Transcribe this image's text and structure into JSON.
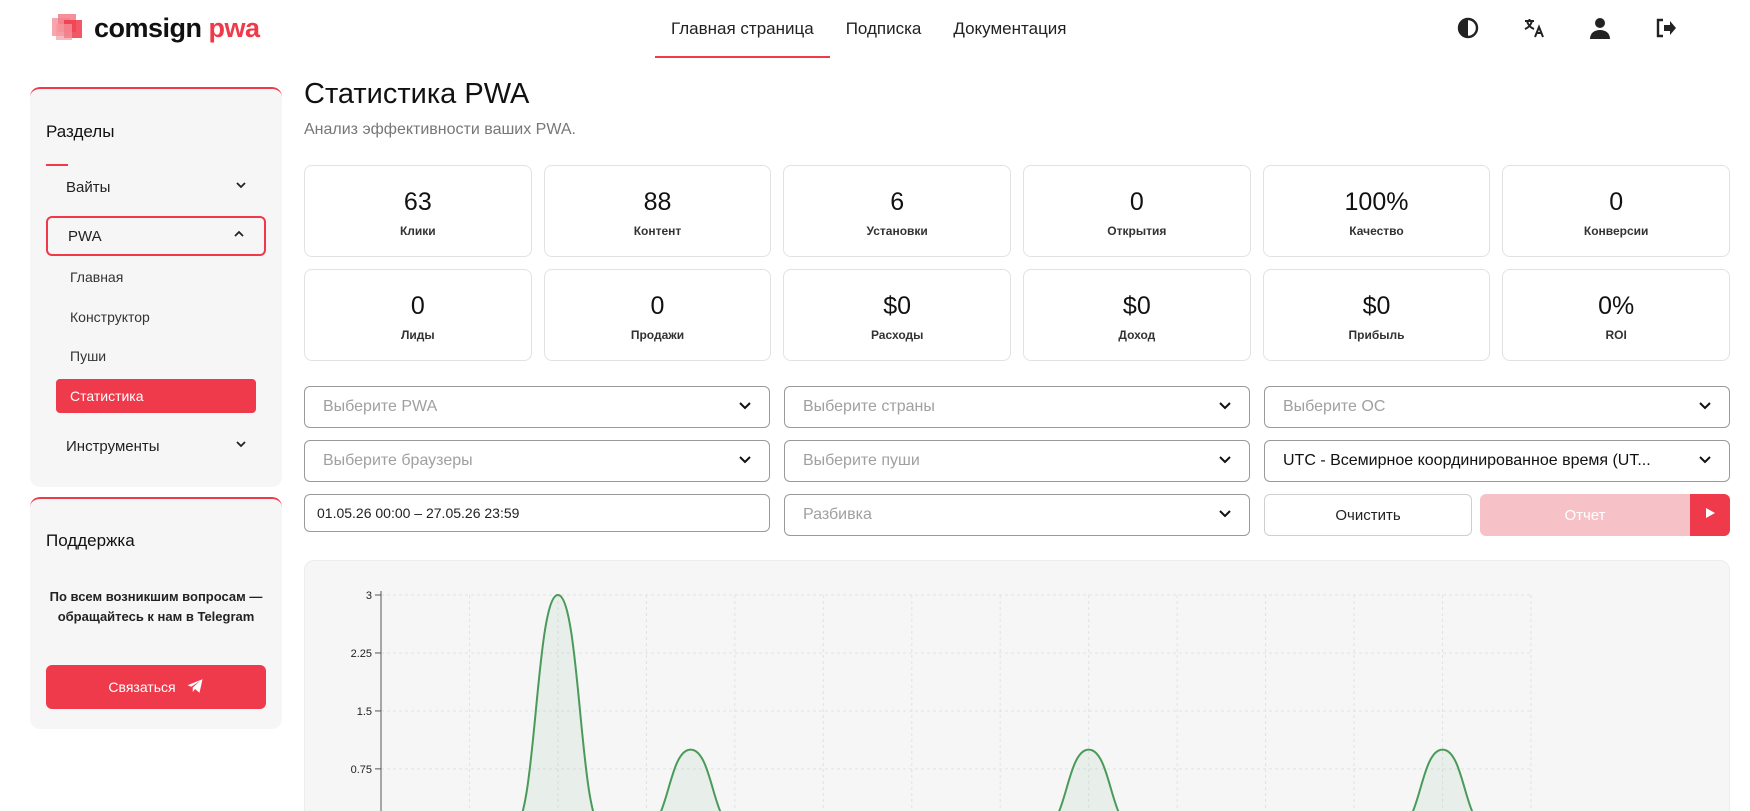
{
  "header": {
    "logo_main": "comsign",
    "logo_accent": "pwa",
    "nav": [
      {
        "label": "Главная страница",
        "active": true
      },
      {
        "label": "Подписка",
        "active": false
      },
      {
        "label": "Документация",
        "active": false
      }
    ],
    "icons": [
      "theme-contrast-icon",
      "translate-icon",
      "user-icon",
      "logout-icon"
    ]
  },
  "sidebar": {
    "sections_title": "Разделы",
    "items": [
      {
        "label": "Вайты",
        "expanded": false
      },
      {
        "label": "PWA",
        "expanded": true,
        "children": [
          {
            "label": "Главная",
            "active": false
          },
          {
            "label": "Конструктор",
            "active": false
          },
          {
            "label": "Пуши",
            "active": false
          },
          {
            "label": "Статистика",
            "active": true
          }
        ]
      },
      {
        "label": "Инструменты",
        "expanded": false
      }
    ],
    "support_title": "Поддержка",
    "support_text": "По всем возникшим вопросам — обращайтесь к нам в Telegram",
    "contact_label": "Связаться"
  },
  "main": {
    "title": "Статистика PWA",
    "subtitle": "Анализ эффективности ваших PWA.",
    "stats": [
      {
        "value": "63",
        "label": "Клики"
      },
      {
        "value": "88",
        "label": "Контент"
      },
      {
        "value": "6",
        "label": "Установки"
      },
      {
        "value": "0",
        "label": "Открытия"
      },
      {
        "value": "100%",
        "label": "Качество"
      },
      {
        "value": "0",
        "label": "Конверсии"
      },
      {
        "value": "0",
        "label": "Лиды"
      },
      {
        "value": "0",
        "label": "Продажи"
      },
      {
        "value": "$0",
        "label": "Расходы"
      },
      {
        "value": "$0",
        "label": "Доход"
      },
      {
        "value": "$0",
        "label": "Прибыль"
      },
      {
        "value": "0%",
        "label": "ROI"
      }
    ],
    "filters": {
      "pwa_placeholder": "Выберите PWA",
      "countries_placeholder": "Выберите страны",
      "os_placeholder": "Выберите ОС",
      "browsers_placeholder": "Выберите браузеры",
      "pushes_placeholder": "Выберите пуши",
      "timezone_value": "UTC - Всемирное координированное время (UT...",
      "date_range": "01.05.26 00:00 – 27.05.26 23:59",
      "breakdown_placeholder": "Разбивка",
      "clear_label": "Очистить",
      "report_label": "Отчет"
    }
  },
  "colors": {
    "accent": "#ee3a4a",
    "accent_disabled": "#f7c2c7",
    "line": "#4a9a5a"
  },
  "chart_data": {
    "type": "area",
    "y_ticks": [
      "3",
      "2.25",
      "1.5",
      "0.75"
    ],
    "ylim": [
      0,
      3
    ],
    "x_count": 27,
    "values": [
      0,
      0,
      0,
      0,
      3,
      0,
      0,
      1,
      0,
      0,
      0,
      0,
      0,
      0,
      0,
      0,
      1,
      0,
      0,
      0,
      0,
      0,
      0,
      0,
      1,
      0,
      0
    ],
    "grid": true
  }
}
